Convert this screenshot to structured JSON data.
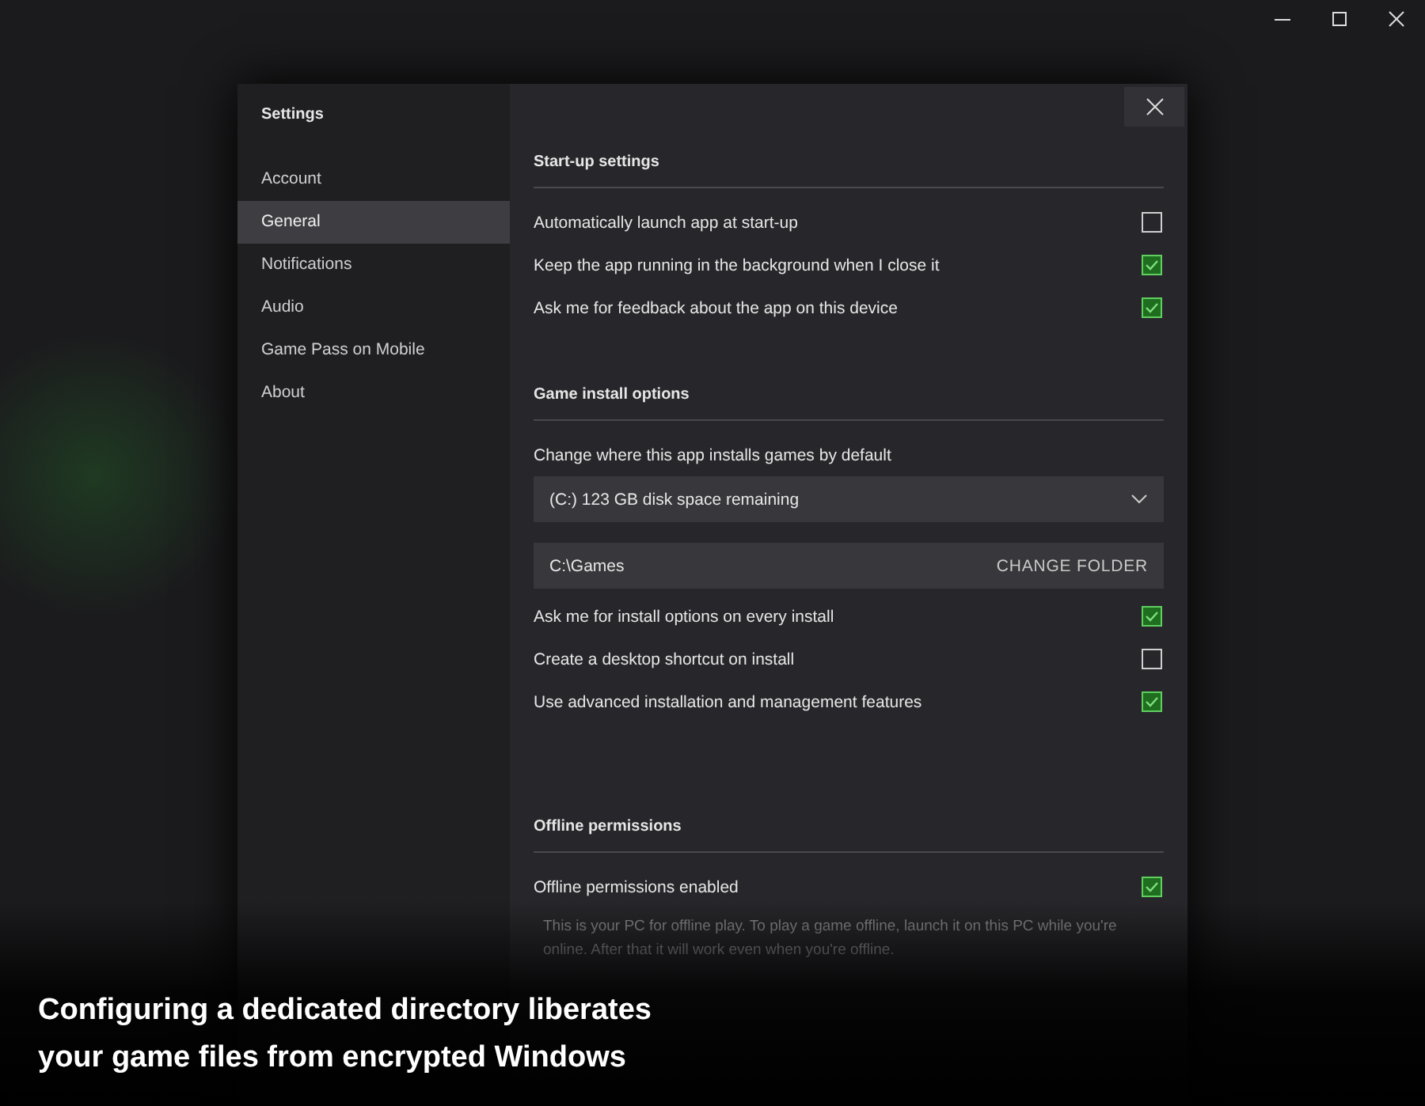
{
  "sidebar": {
    "title": "Settings",
    "items": [
      {
        "label": "Account",
        "selected": false
      },
      {
        "label": "General",
        "selected": true
      },
      {
        "label": "Notifications",
        "selected": false
      },
      {
        "label": "Audio",
        "selected": false
      },
      {
        "label": "Game Pass on Mobile",
        "selected": false
      },
      {
        "label": "About",
        "selected": false
      }
    ]
  },
  "sections": [
    {
      "title": "Start-up settings",
      "items": [
        {
          "kind": "checkbox",
          "label": "Automatically launch app at start-up",
          "checked": false
        },
        {
          "kind": "checkbox",
          "label": "Keep the app running in the background when I close it",
          "checked": true
        },
        {
          "kind": "checkbox",
          "label": "Ask me for feedback about the app on this device",
          "checked": true
        }
      ]
    },
    {
      "title": "Game install options",
      "items": [
        {
          "kind": "text",
          "label": "Change where this app installs games by default"
        },
        {
          "kind": "dropdown",
          "value": "(C:) 123 GB disk space remaining"
        },
        {
          "kind": "folder",
          "value": "C:\\Games",
          "button": "CHANGE FOLDER"
        },
        {
          "kind": "checkbox",
          "label": "Ask me for install options on every install",
          "checked": true
        },
        {
          "kind": "checkbox",
          "label": "Create a desktop shortcut on install",
          "checked": false
        },
        {
          "kind": "checkbox",
          "label": "Use advanced installation and management features",
          "checked": true
        }
      ]
    },
    {
      "title": "Offline permissions",
      "items": [
        {
          "kind": "checkbox",
          "label": "Offline permissions enabled",
          "checked": true
        },
        {
          "kind": "note",
          "label": "This is your PC for offline play. To play a game offline, launch it on this PC while you're online. After that it will work even when you're offline."
        }
      ]
    }
  ],
  "caption": "Configuring a dedicated directory liberates your game files from encrypted Windows"
}
